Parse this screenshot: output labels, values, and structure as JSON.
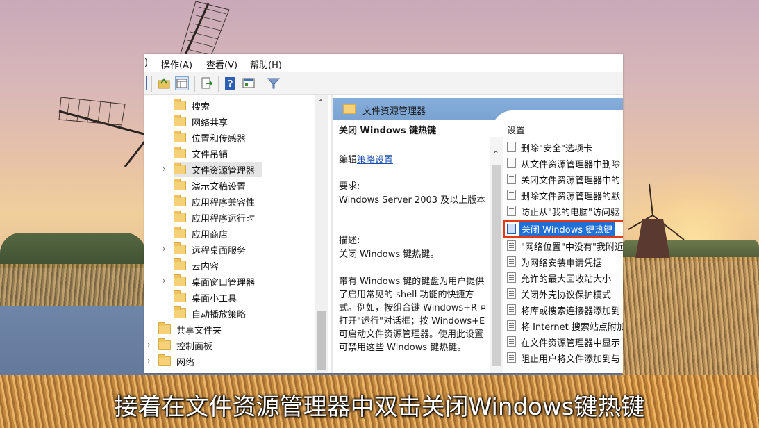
{
  "menubar": {
    "partial": ")",
    "action": "操作(A)",
    "view": "查看(V)",
    "help": "帮助(H)"
  },
  "tree": {
    "items": [
      {
        "label": "搜索"
      },
      {
        "label": "网络共享"
      },
      {
        "label": "位置和传感器"
      },
      {
        "label": "文件吊销"
      },
      {
        "label": "文件资源管理器"
      },
      {
        "label": "演示文稿设置"
      },
      {
        "label": "应用程序兼容性"
      },
      {
        "label": "应用程序运行时"
      },
      {
        "label": "应用商店"
      },
      {
        "label": "远程桌面服务"
      },
      {
        "label": "云内容"
      },
      {
        "label": "桌面窗口管理器"
      },
      {
        "label": "桌面小工具"
      },
      {
        "label": "自动播放策略"
      },
      {
        "label": "共享文件夹"
      },
      {
        "label": "控制面板"
      },
      {
        "label": "网络"
      }
    ]
  },
  "right": {
    "header_title": "文件资源管理器",
    "policy_title": "关闭 Windows 键热键",
    "edit_prefix": "编辑",
    "edit_link": "策略设置",
    "requirements_label": "要求:",
    "requirements_text": "Windows Server 2003 及以上版本",
    "description_label": "描述:",
    "description_short": "关闭 Windows 键热键。",
    "description_long": "带有 Windows 键的键盘为用户提供了启用常见的 shell 功能的快捷方式。例如，按组合键 Windows+R 可打开\"运行\"对话框；按 Windows+E 可启动文件资源管理器。使用此设置可禁用这些 Windows 键热键。",
    "settings_header": "设置",
    "settings": [
      {
        "label": "删除\"安全\"选项卡"
      },
      {
        "label": "从文件资源管理器中删除"
      },
      {
        "label": "关闭文件资源管理器中的"
      },
      {
        "label": "删除文件资源管理器的默"
      },
      {
        "label": "防止从\"我的电脑\"访问驱"
      },
      {
        "label": "关闭 Windows 键热键"
      },
      {
        "label": "\"网络位置\"中没有\"我附近"
      },
      {
        "label": "为网络安装申请凭据"
      },
      {
        "label": "允许的最大回收站大小"
      },
      {
        "label": "关闭外壳协议保护模式"
      },
      {
        "label": "将库或搜索连接器添加到"
      },
      {
        "label": "将 Internet 搜索站点附加"
      },
      {
        "label": "在文件资源管理器中显示"
      },
      {
        "label": "阻止用户将文件添加到与"
      }
    ]
  },
  "subtitle": "接着在文件资源管理器中双击关闭Windows键热键",
  "colors": {
    "highlight_border": "#e23a15",
    "selection": "#1f6fd6",
    "header_blue": "#7aa3d2"
  }
}
